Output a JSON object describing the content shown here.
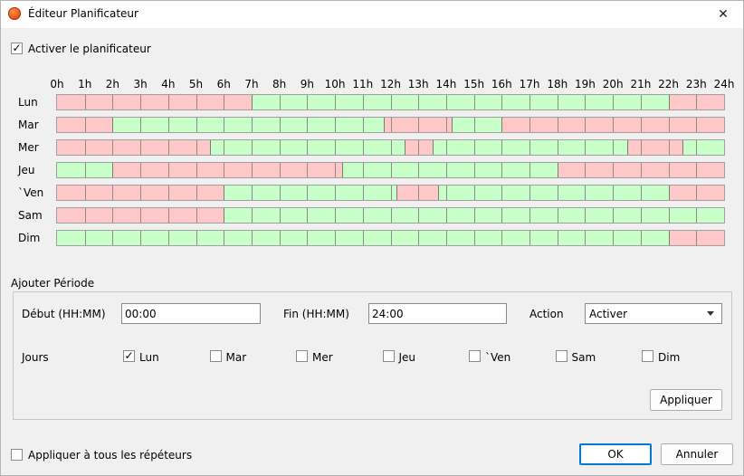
{
  "window": {
    "title": "Éditeur Planificateur",
    "close_glyph": "✕",
    "icon": "orange-app-icon"
  },
  "enable_scheduler": {
    "label": "Activer le planificateur",
    "checked": true
  },
  "schedule": {
    "hours": [
      "0h",
      "1h",
      "2h",
      "3h",
      "4h",
      "5h",
      "6h",
      "7h",
      "8h",
      "9h",
      "10h",
      "11h",
      "12h",
      "13h",
      "14h",
      "15h",
      "16h",
      "17h",
      "18h",
      "19h",
      "20h",
      "21h",
      "22h",
      "23h",
      "24h"
    ],
    "colors": {
      "active": "#c8ffc8",
      "inactive": "#ffc8c8"
    },
    "days": [
      {
        "label": "Lun",
        "segments": [
          {
            "start": 0,
            "end": 7,
            "state": "inactive"
          },
          {
            "start": 7,
            "end": 22,
            "state": "active"
          },
          {
            "start": 22,
            "end": 24,
            "state": "inactive"
          }
        ]
      },
      {
        "label": "Mar",
        "segments": [
          {
            "start": 0,
            "end": 2,
            "state": "inactive"
          },
          {
            "start": 2,
            "end": 11.75,
            "state": "active"
          },
          {
            "start": 11.75,
            "end": 14.2,
            "state": "inactive"
          },
          {
            "start": 14.2,
            "end": 16,
            "state": "active"
          },
          {
            "start": 16,
            "end": 24,
            "state": "inactive"
          }
        ]
      },
      {
        "label": "Mer",
        "segments": [
          {
            "start": 0,
            "end": 5.5,
            "state": "inactive"
          },
          {
            "start": 5.5,
            "end": 12.5,
            "state": "active"
          },
          {
            "start": 12.5,
            "end": 13.5,
            "state": "inactive"
          },
          {
            "start": 13.5,
            "end": 20.5,
            "state": "active"
          },
          {
            "start": 20.5,
            "end": 22.5,
            "state": "inactive"
          },
          {
            "start": 22.5,
            "end": 24,
            "state": "active"
          }
        ]
      },
      {
        "label": "Jeu",
        "segments": [
          {
            "start": 0,
            "end": 2,
            "state": "active"
          },
          {
            "start": 2,
            "end": 10.25,
            "state": "inactive"
          },
          {
            "start": 10.25,
            "end": 18,
            "state": "active"
          },
          {
            "start": 18,
            "end": 24,
            "state": "inactive"
          }
        ]
      },
      {
        "label": "`Ven",
        "segments": [
          {
            "start": 0,
            "end": 6,
            "state": "inactive"
          },
          {
            "start": 6,
            "end": 12.2,
            "state": "active"
          },
          {
            "start": 12.2,
            "end": 13.7,
            "state": "inactive"
          },
          {
            "start": 13.7,
            "end": 22,
            "state": "active"
          },
          {
            "start": 22,
            "end": 24,
            "state": "inactive"
          }
        ]
      },
      {
        "label": "Sam",
        "segments": [
          {
            "start": 0,
            "end": 6,
            "state": "inactive"
          },
          {
            "start": 6,
            "end": 24,
            "state": "active"
          }
        ]
      },
      {
        "label": "Dim",
        "segments": [
          {
            "start": 0,
            "end": 22,
            "state": "active"
          },
          {
            "start": 22,
            "end": 24,
            "state": "inactive"
          }
        ]
      }
    ]
  },
  "add_period": {
    "group_title": "Ajouter Période",
    "start_label": "Début (HH:MM)",
    "start_value": "00:00",
    "end_label": "Fin (HH:MM)",
    "end_value": "24:00",
    "action_label": "Action",
    "action_value": "Activer",
    "days_label": "Jours",
    "day_checks": [
      {
        "label": "Lun",
        "checked": true
      },
      {
        "label": "Mar",
        "checked": false
      },
      {
        "label": "Mer",
        "checked": false
      },
      {
        "label": "Jeu",
        "checked": false
      },
      {
        "label": "`Ven",
        "checked": false
      },
      {
        "label": "Sam",
        "checked": false
      },
      {
        "label": "Dim",
        "checked": false
      }
    ],
    "apply_label": "Appliquer"
  },
  "footer": {
    "apply_all_label": "Appliquer à tous les répéteurs",
    "apply_all_checked": false,
    "ok_label": "OK",
    "cancel_label": "Annuler"
  }
}
